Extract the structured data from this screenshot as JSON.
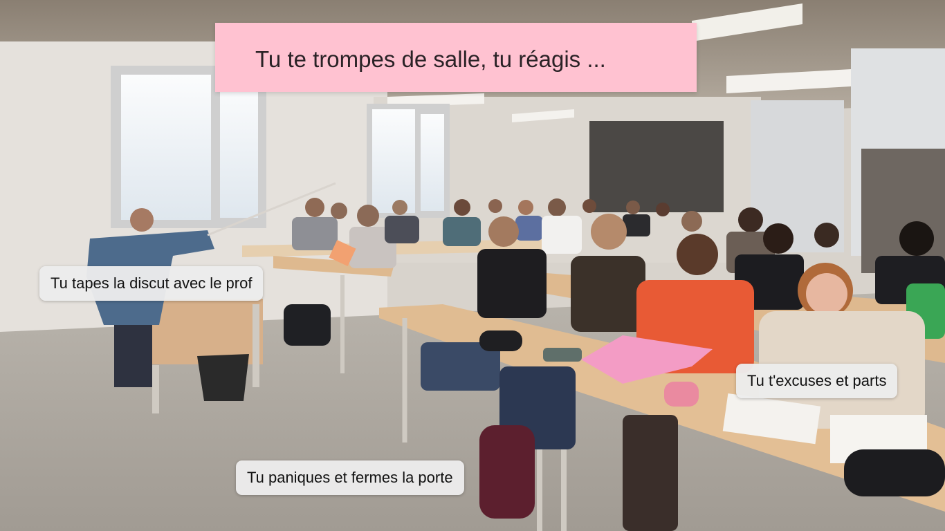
{
  "game": {
    "question": "Tu te trompes de salle, tu réagis ...",
    "choices": [
      "Tu tapes la discut avec le prof",
      "Tu t'excuses et parts",
      "Tu paniques et fermes la porte"
    ]
  }
}
